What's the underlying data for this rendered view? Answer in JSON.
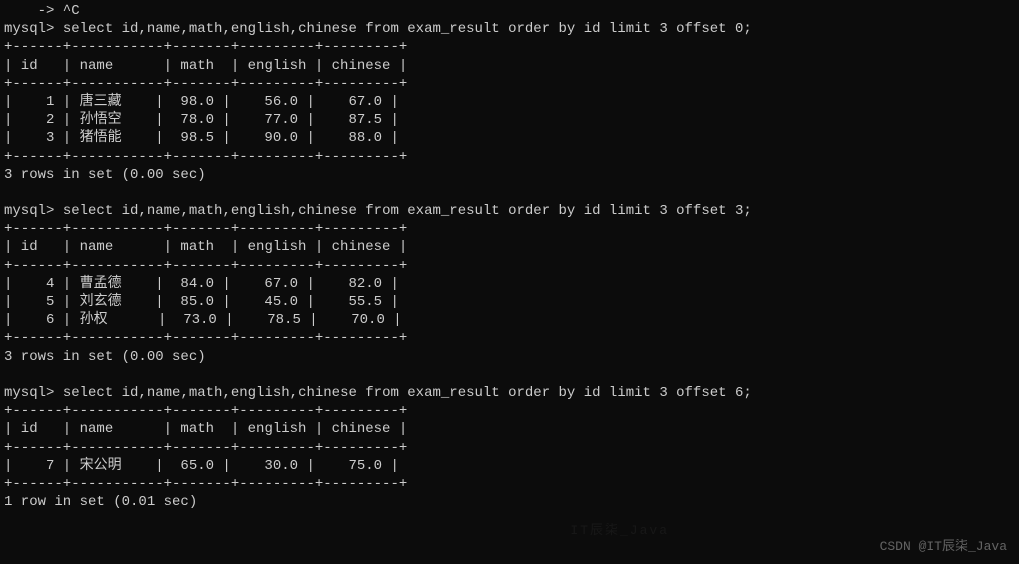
{
  "terminal": {
    "line0": "    -> ^C",
    "prompt": "mysql>",
    "queries": [
      {
        "sql": "select id,name,math,english,chinese from exam_result order by id limit 3 offset 0;",
        "divider": "+------+-----------+-------+---------+---------+",
        "header": "| id   | name      | math  | english | chinese |",
        "rows": [
          "|    1 | 唐三藏    |  98.0 |    56.0 |    67.0 |",
          "|    2 | 孙悟空    |  78.0 |    77.0 |    87.5 |",
          "|    3 | 猪悟能    |  98.5 |    90.0 |    88.0 |"
        ],
        "footer": "3 rows in set (0.00 sec)"
      },
      {
        "sql": "select id,name,math,english,chinese from exam_result order by id limit 3 offset 3;",
        "divider": "+------+-----------+-------+---------+---------+",
        "header": "| id   | name      | math  | english | chinese |",
        "rows": [
          "|    4 | 曹孟德    |  84.0 |    67.0 |    82.0 |",
          "|    5 | 刘玄德    |  85.0 |    45.0 |    55.5 |",
          "|    6 | 孙权      |  73.0 |    78.5 |    70.0 |"
        ],
        "footer": "3 rows in set (0.00 sec)"
      },
      {
        "sql": "select id,name,math,english,chinese from exam_result order by id limit 3 offset 6;",
        "divider": "+------+-----------+-------+---------+---------+",
        "header": "| id   | name      | math  | english | chinese |",
        "rows": [
          "|    7 | 宋公明    |  65.0 |    30.0 |    75.0 |"
        ],
        "footer": "1 row in set (0.01 sec)"
      }
    ]
  },
  "watermark": "CSDN @IT辰柒_Java",
  "faint_watermark": "IT辰柒_Java"
}
